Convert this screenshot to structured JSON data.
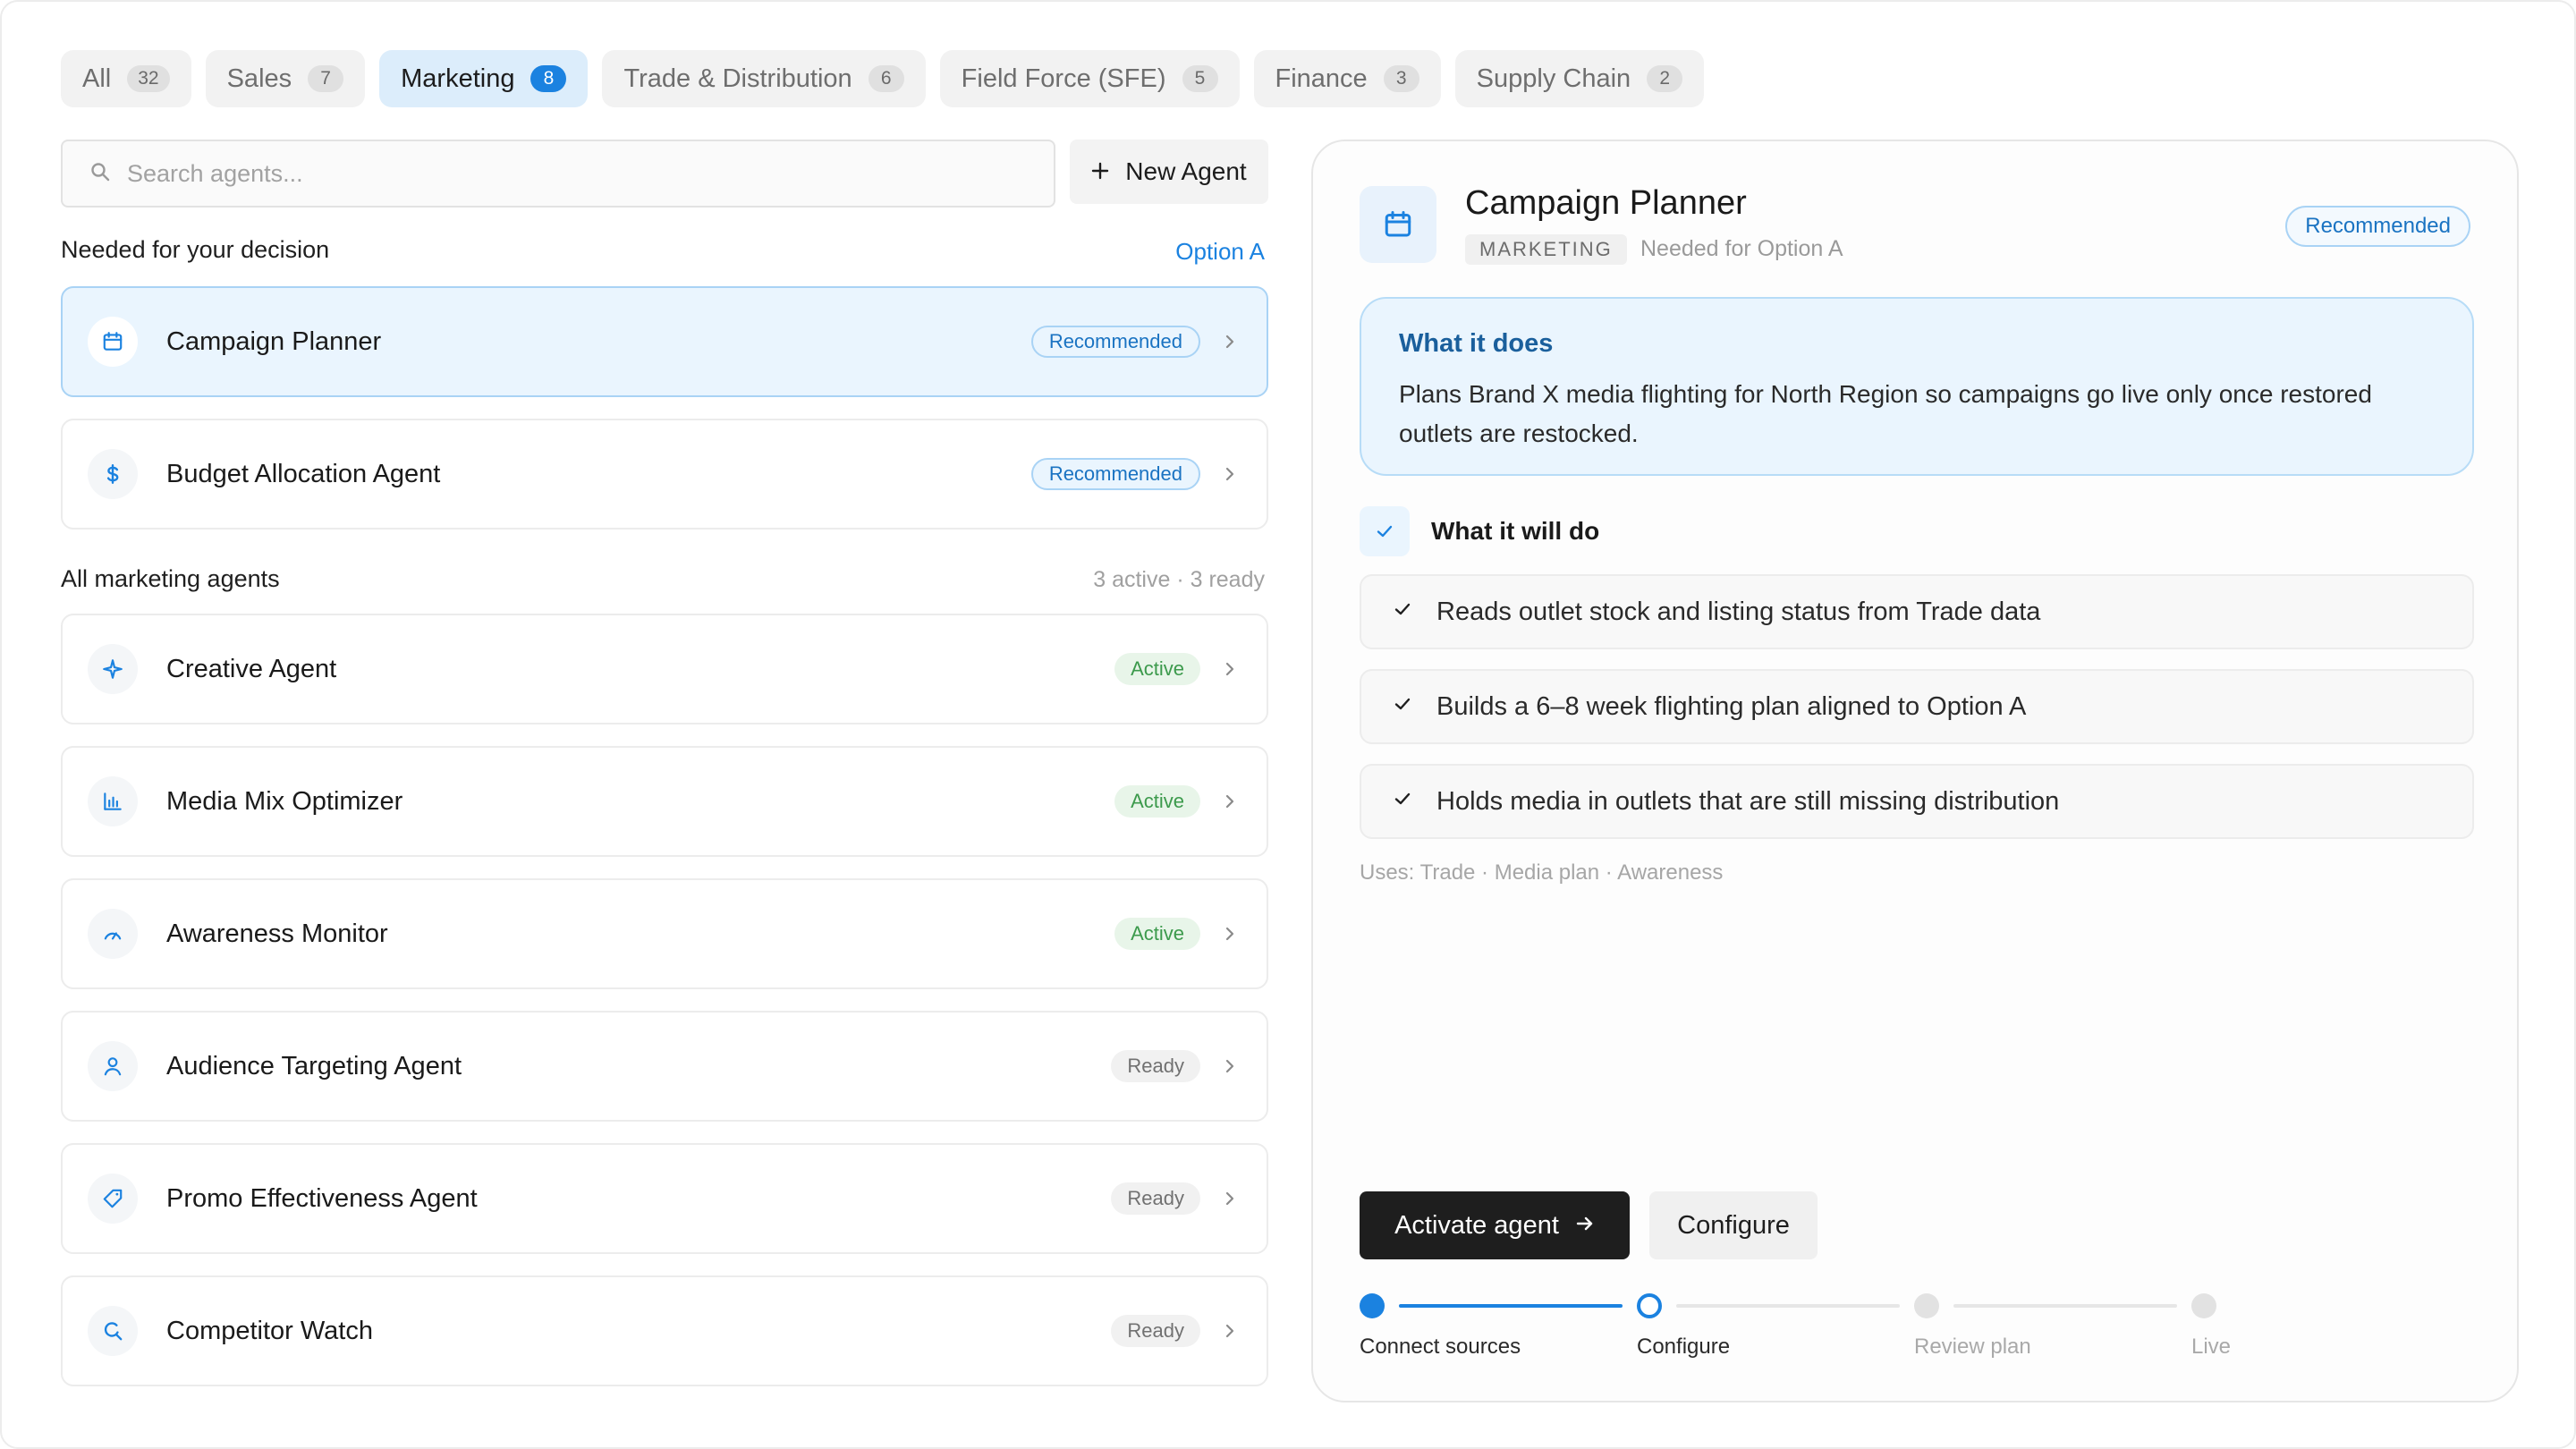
{
  "tabs": [
    {
      "label": "All",
      "count": "32",
      "active": false
    },
    {
      "label": "Sales",
      "count": "7",
      "active": false
    },
    {
      "label": "Marketing",
      "count": "8",
      "active": true
    },
    {
      "label": "Trade & Distribution",
      "count": "6",
      "active": false
    },
    {
      "label": "Field Force (SFE)",
      "count": "5",
      "active": false
    },
    {
      "label": "Finance",
      "count": "3",
      "active": false
    },
    {
      "label": "Supply Chain",
      "count": "2",
      "active": false
    }
  ],
  "search": {
    "placeholder": "Search agents..."
  },
  "new_agent_label": "New Agent",
  "decision_section": {
    "label": "Needed for your decision",
    "link": "Option A"
  },
  "decision_agents": [
    {
      "name": "Campaign Planner",
      "icon": "calendar-icon",
      "badge": "Recommended",
      "status": "recommended"
    },
    {
      "name": "Budget Allocation Agent",
      "icon": "dollar-icon",
      "badge": "Recommended",
      "status": "recommended"
    }
  ],
  "all_section": {
    "label": "All marketing agents",
    "meta": "3 active · 3 ready"
  },
  "all_agents": [
    {
      "name": "Creative Agent",
      "icon": "sparkle-icon",
      "badge": "Active",
      "status": "active"
    },
    {
      "name": "Media Mix Optimizer",
      "icon": "bar-chart-icon",
      "badge": "Active",
      "status": "active"
    },
    {
      "name": "Awareness Monitor",
      "icon": "gauge-icon",
      "badge": "Active",
      "status": "active"
    },
    {
      "name": "Audience Targeting Agent",
      "icon": "user-icon",
      "badge": "Ready",
      "status": "ready"
    },
    {
      "name": "Promo Effectiveness Agent",
      "icon": "tag-icon",
      "badge": "Ready",
      "status": "ready"
    },
    {
      "name": "Competitor Watch",
      "icon": "search-icon",
      "badge": "Ready",
      "status": "ready"
    }
  ],
  "detail": {
    "title": "Campaign Planner",
    "category": "MARKETING",
    "needed_for": "Needed for Option A",
    "badge": "Recommended",
    "what_it_does_title": "What it does",
    "what_it_does": "Plans Brand X media flighting for North Region so campaigns go live only once restored outlets are restocked.",
    "will_do_title": "What it will do",
    "will_do": [
      "Reads outlet stock and listing status from Trade data",
      "Builds a 6–8 week flighting plan aligned to Option A",
      "Holds media in outlets that are still missing distribution"
    ],
    "uses": "Uses: Trade · Media plan · Awareness",
    "activate_label": "Activate agent",
    "configure_label": "Configure",
    "steps": [
      {
        "label": "Connect sources",
        "state": "done"
      },
      {
        "label": "Configure",
        "state": "current"
      },
      {
        "label": "Review plan",
        "state": "todo"
      },
      {
        "label": "Live",
        "state": "todo"
      }
    ]
  },
  "colors": {
    "accent": "#1b82e0",
    "selected_bg": "#eaf5fe",
    "active_green": "#3c9a4c",
    "dark_button": "#1e1e1e"
  }
}
